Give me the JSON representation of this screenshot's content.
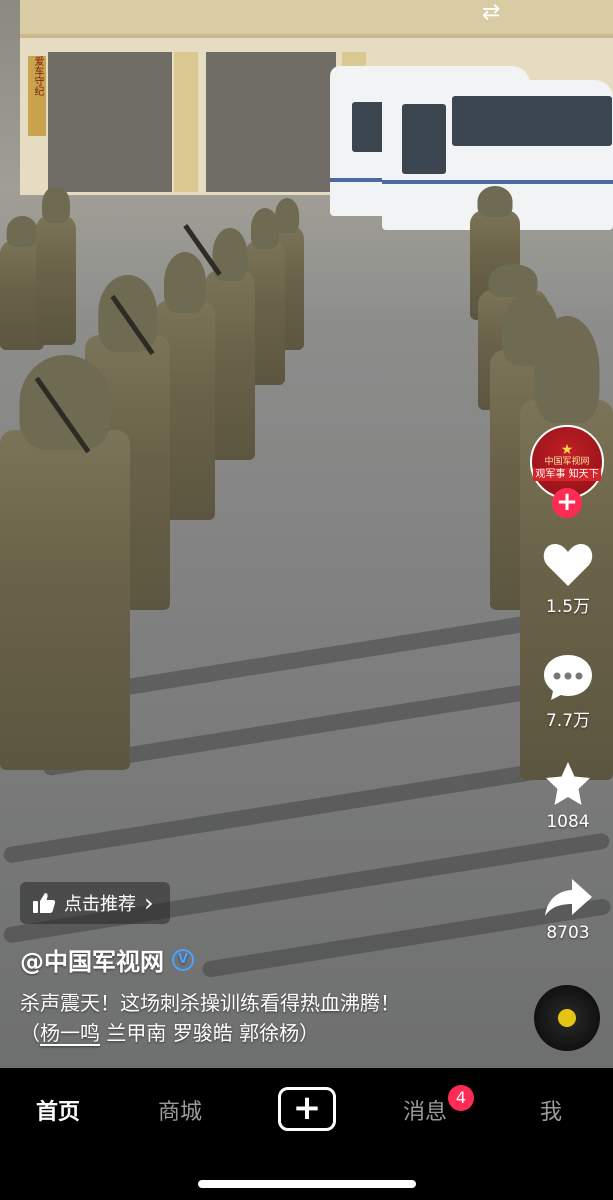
{
  "video": {
    "signage": "爱车守纪"
  },
  "top": {
    "swap_icon": "⇄"
  },
  "sidebar": {
    "avatar_top": "中国军视网",
    "avatar_bottom": "观军事 知天下",
    "follow_icon": "+",
    "like_count": "1.5万",
    "comment_count": "7.7万",
    "favorite_count": "1084",
    "share_count": "8703"
  },
  "post": {
    "recommend_label": "点击推荐",
    "recommend_chevron": "›",
    "author": "@中国军视网",
    "verified_icon": "V",
    "caption_line1": "杀声震天！这场刺杀操训练看得热血沸腾！",
    "caption_open": "（",
    "caption_tags": [
      "杨一鸣",
      "兰甲南",
      "罗骏皓",
      "郭徐杨"
    ],
    "caption_close": "）"
  },
  "tabbar": {
    "home": "首页",
    "mall": "商城",
    "create": "+",
    "messages": "消息",
    "messages_badge": "4",
    "me": "我"
  },
  "colors": {
    "accent": "#fe2c55",
    "badge": "#fe2c55",
    "disc_core": "#e6c414"
  }
}
